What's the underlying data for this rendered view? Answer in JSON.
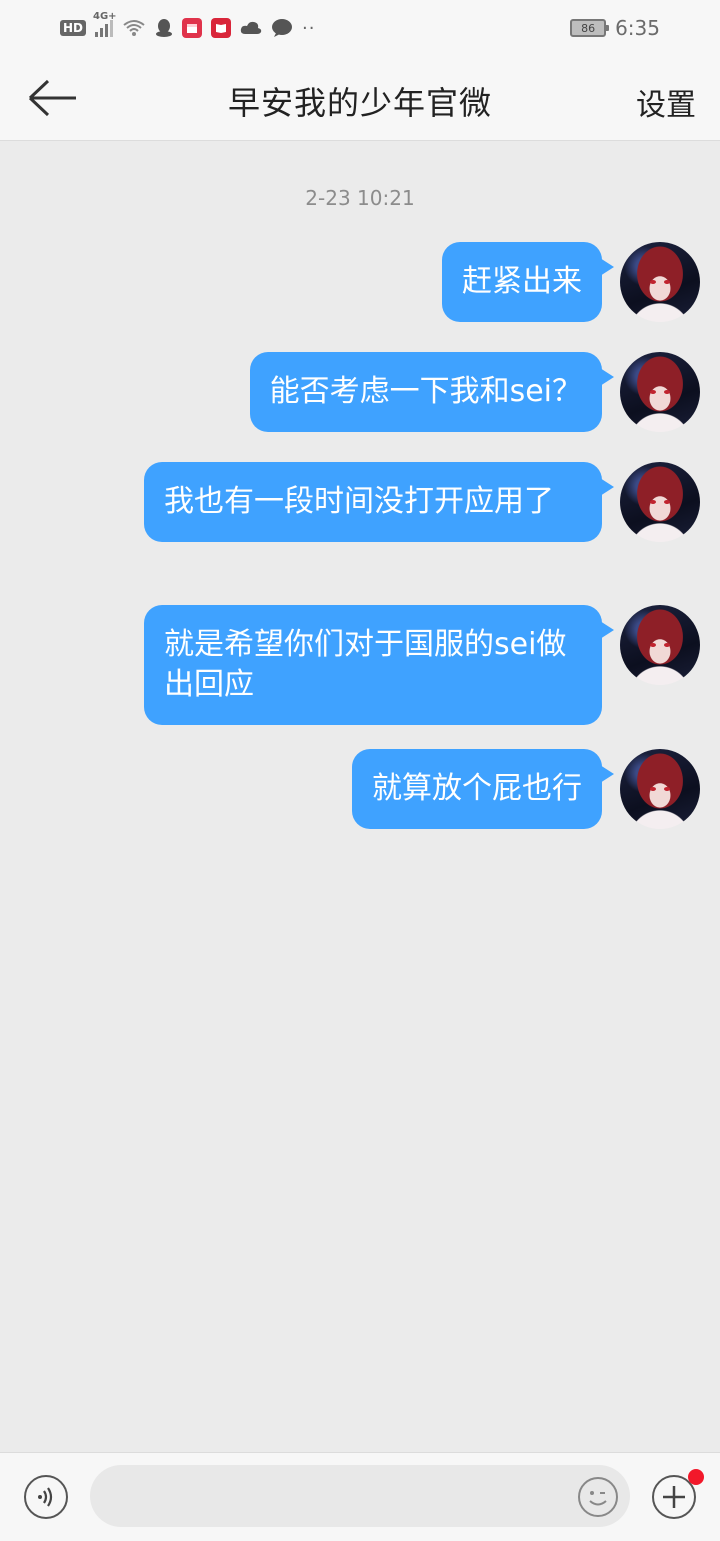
{
  "status_bar": {
    "hd": "HD",
    "network": "4G+",
    "battery": "86",
    "time": "6:35",
    "dots": "··",
    "icons": [
      "hd-icon",
      "signal-icon",
      "wifi-icon",
      "qq-icon",
      "calendar-app-icon",
      "book-app-icon",
      "cloud-icon",
      "message-icon"
    ]
  },
  "header": {
    "title": "早安我的少年官微",
    "settings_label": "设置"
  },
  "chat": {
    "timestamp": "2-23 10:21",
    "bubble_color": "#3fa2ff",
    "messages": [
      {
        "text": "赶紧出来"
      },
      {
        "text": "能否考虑一下我和sei？"
      },
      {
        "text": "我也有一段时间没打开应用了"
      },
      {
        "text": "就是希望你们对于国服的sei做出回应"
      },
      {
        "text": "就算放个屁也行"
      }
    ]
  },
  "input_bar": {
    "placeholder": "",
    "has_notification": true,
    "notification_color": "#f2182a"
  }
}
